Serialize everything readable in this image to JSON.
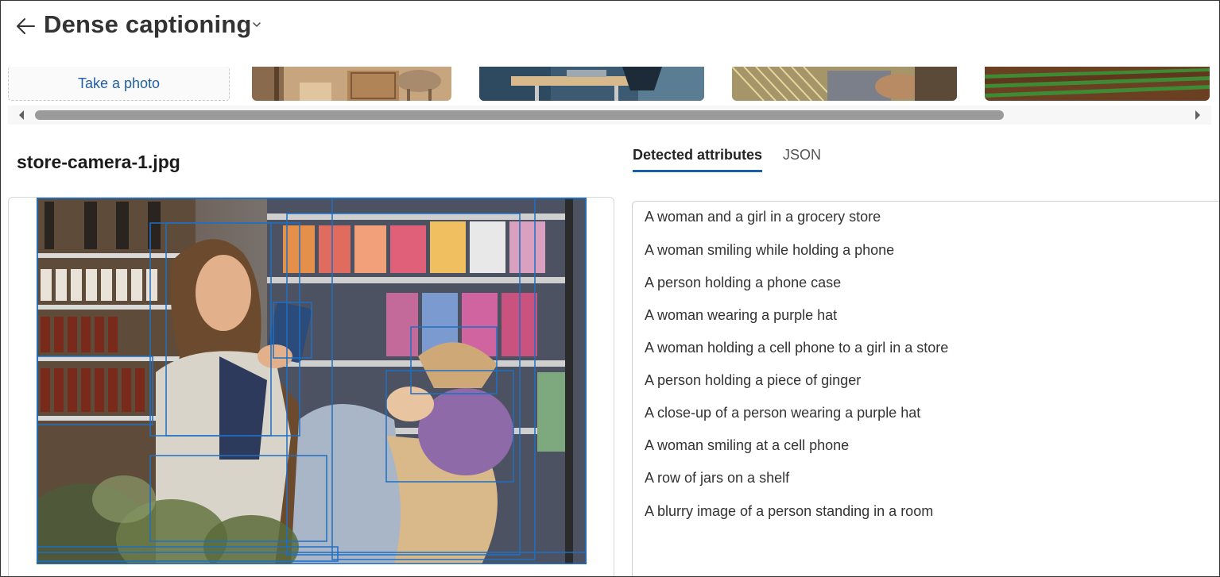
{
  "header": {
    "title": "Dense captioning"
  },
  "gallery": {
    "take_photo_label": "Take a photo",
    "thumbnails": [
      "cat-on-box-icon",
      "office-desk-icon",
      "loom-weaving-icon",
      "crop-field-icon"
    ]
  },
  "file": {
    "name": "store-camera-1.jpg"
  },
  "tabs": [
    {
      "label": "Detected attributes",
      "active": true
    },
    {
      "label": "JSON",
      "active": false
    }
  ],
  "captions": [
    "A woman and a girl in a grocery store",
    "A woman smiling while holding a phone",
    "A person holding a phone case",
    "A woman wearing a purple hat",
    "A woman holding a cell phone to a girl in a store",
    "A person holding a piece of ginger",
    "A close-up of a person wearing a purple hat",
    "A woman smiling at a cell phone",
    "A row of jars on a shelf",
    "A blurry image of a person standing in a room"
  ],
  "colors": {
    "accent": "#1a5fae",
    "box": "#1f6fc2"
  }
}
